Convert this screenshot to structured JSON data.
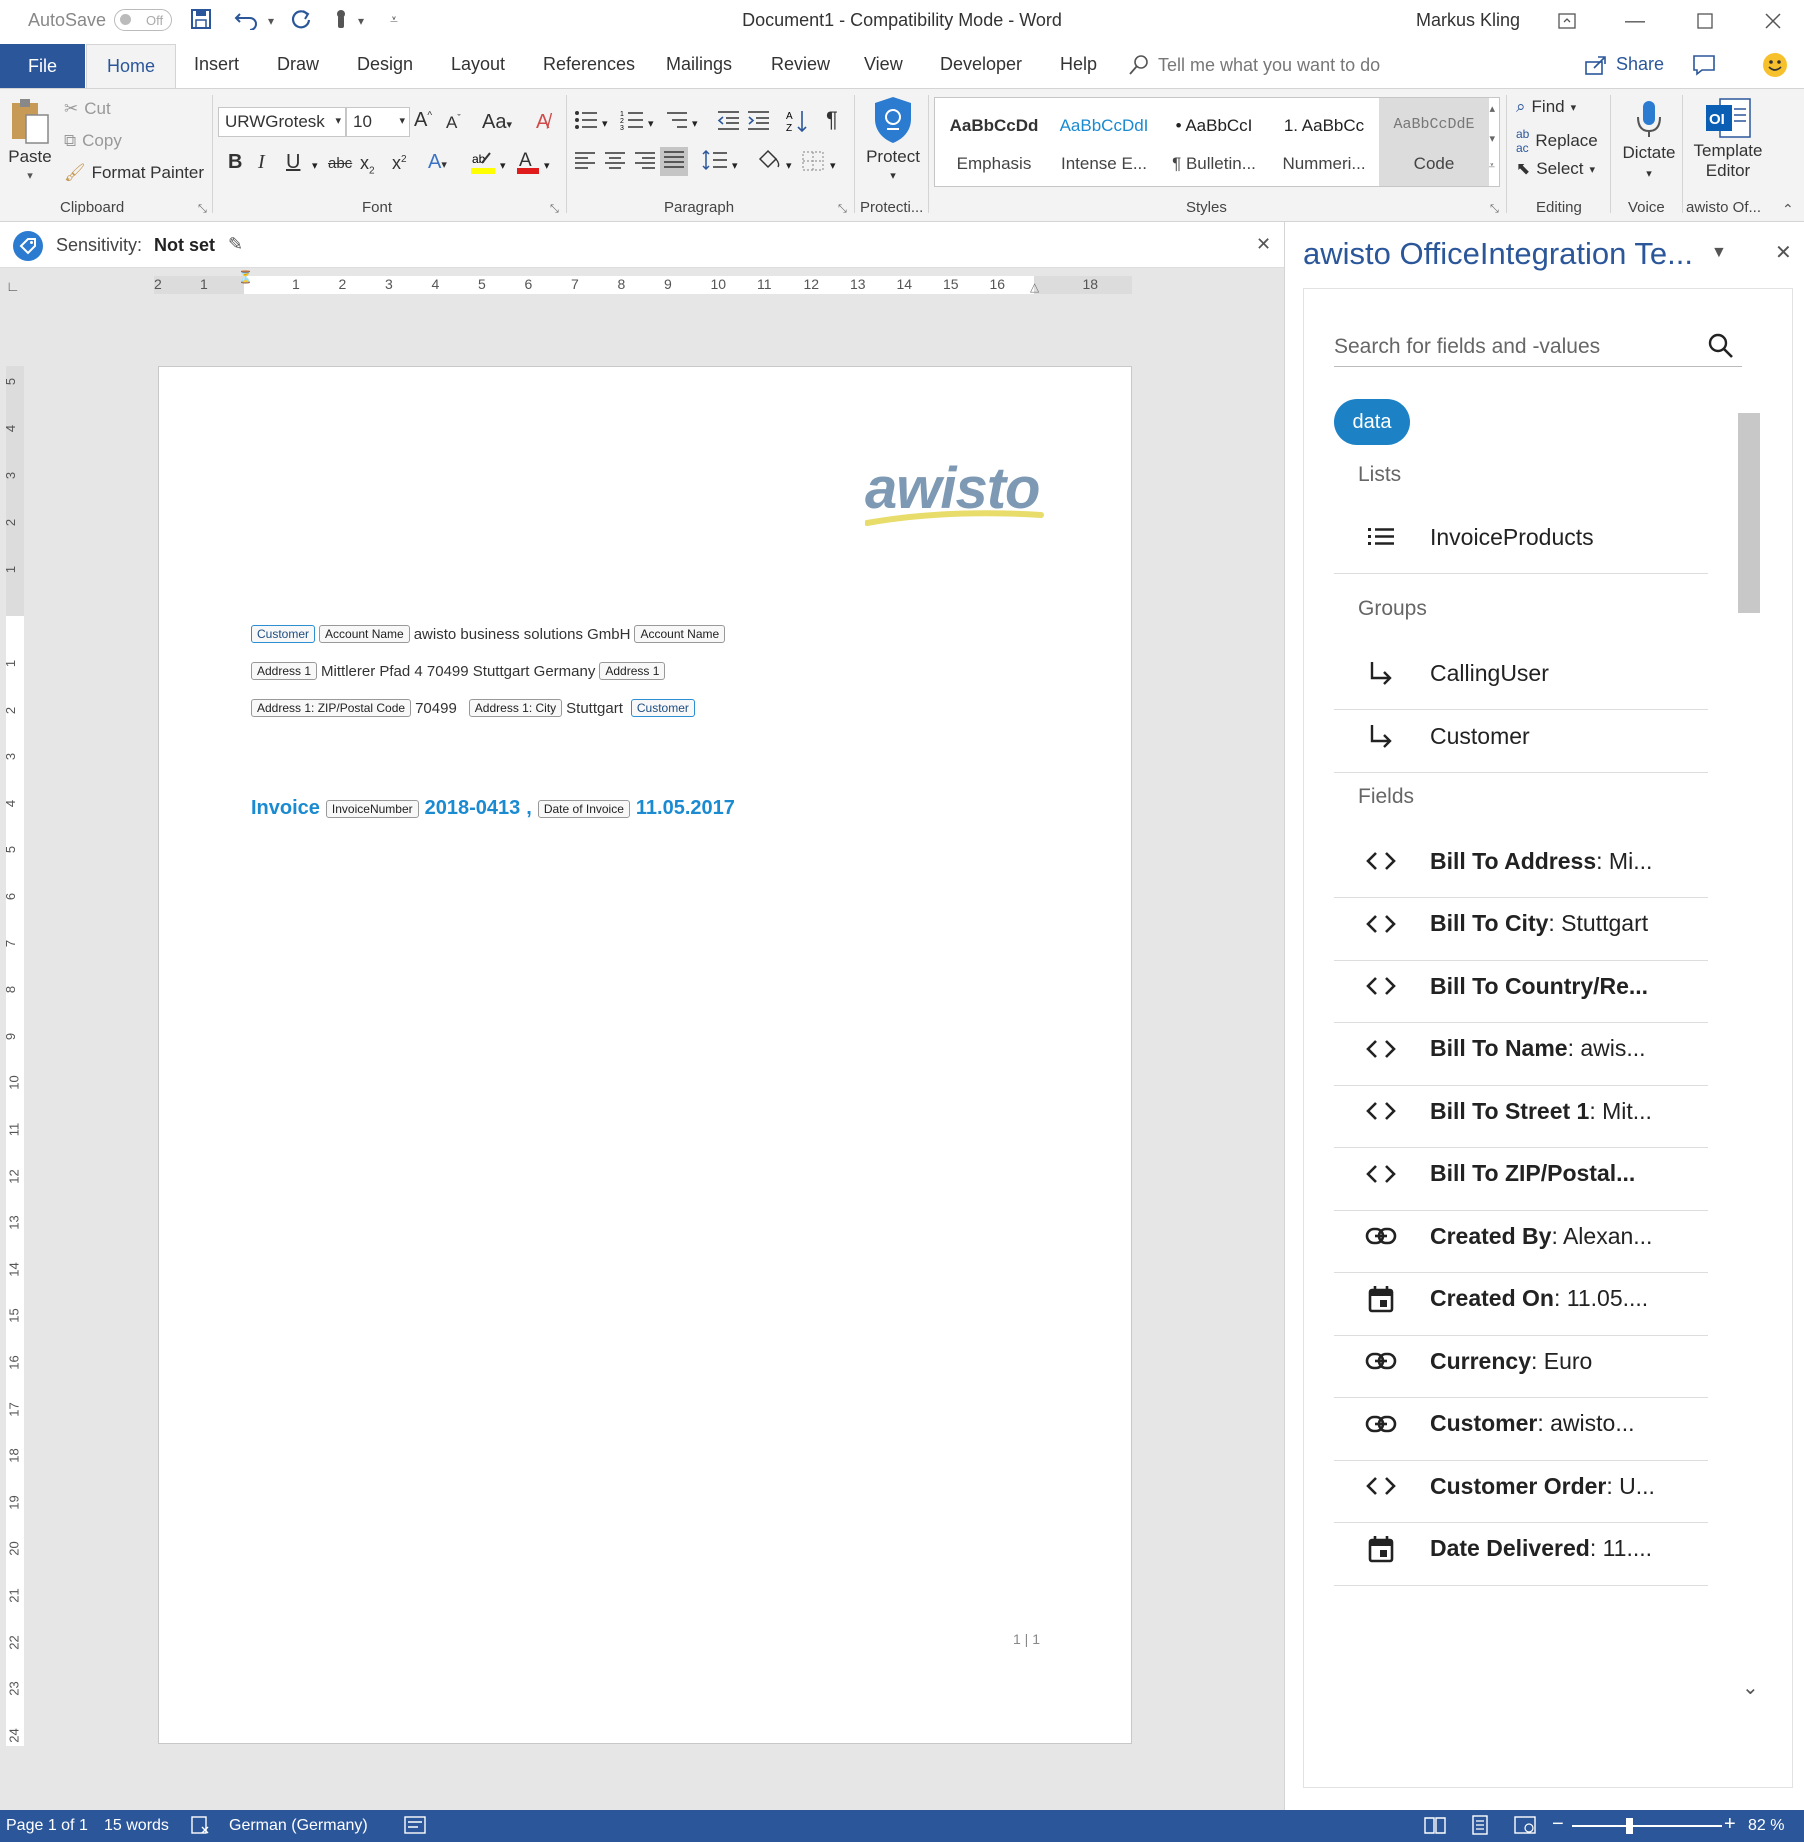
{
  "titlebar": {
    "autosave_label": "AutoSave",
    "autosave_state": "Off",
    "document_title": "Document1  -  Compatibility Mode  -  Word",
    "user_name": "Markus Kling"
  },
  "tabs": {
    "file": "File",
    "home": "Home",
    "items": [
      "Insert",
      "Draw",
      "Design",
      "Layout",
      "References",
      "Mailings",
      "Review",
      "View",
      "Developer",
      "Help"
    ],
    "tell_me_placeholder": "Tell me what you want to do",
    "share": "Share"
  },
  "ribbon": {
    "clipboard": {
      "paste": "Paste",
      "cut": "Cut",
      "copy": "Copy",
      "format_painter": "Format Painter",
      "label": "Clipboard"
    },
    "font": {
      "name": "URWGrotesk",
      "size": "10",
      "label": "Font",
      "bold": "B",
      "italic": "I",
      "underline": "U",
      "strike": "abc",
      "case": "Aa"
    },
    "paragraph": {
      "label": "Paragraph"
    },
    "protection": {
      "protect": "Protect",
      "label": "Protecti..."
    },
    "styles": {
      "label": "Styles",
      "items": [
        {
          "sample": "AaBbCcDd",
          "name": "Emphasis"
        },
        {
          "sample": "AaBbCcDdI",
          "name": "Intense E..."
        },
        {
          "sample": "• AaBbCcI",
          "name": "¶ Bulletin..."
        },
        {
          "sample": "1.  AaBbCc",
          "name": "Nummeri..."
        },
        {
          "sample": "AaBbCcDdE",
          "name": "Code"
        }
      ]
    },
    "editing": {
      "find": "Find",
      "replace": "Replace",
      "select": "Select",
      "label": "Editing"
    },
    "voice": {
      "dictate": "Dictate",
      "label": "Voice"
    },
    "addin": {
      "template": "Template",
      "editor": "Editor",
      "label": "awisto Of..."
    }
  },
  "sensitivity": {
    "label": "Sensitivity:",
    "value": "Not set"
  },
  "ruler": {
    "h_left": [
      "2",
      "1"
    ],
    "h_right": [
      "1",
      "2",
      "3",
      "4",
      "5",
      "6",
      "7",
      "8",
      "9",
      "10",
      "11",
      "12",
      "13",
      "14",
      "15",
      "16",
      "18"
    ],
    "v_top": [
      "5",
      "4",
      "3",
      "2",
      "1"
    ],
    "v_bottom": [
      "1",
      "2",
      "3",
      "4",
      "5",
      "6",
      "7",
      "8",
      "9",
      "10",
      "11",
      "12",
      "13",
      "14",
      "15",
      "16",
      "17",
      "18",
      "19",
      "20",
      "21",
      "22",
      "23",
      "24"
    ]
  },
  "document": {
    "logo": "awisto",
    "line1": {
      "cc_customer": "Customer",
      "cc_account": "Account Name",
      "value": "awisto business solutions GmbH",
      "cc_account_end": "Account Name"
    },
    "line2": {
      "cc_address": "Address 1",
      "value": "Mittlerer Pfad 4 70499 Stuttgart Germany",
      "cc_address_end": "Address 1"
    },
    "line3": {
      "cc_zip": "Address 1: ZIP/Postal Code",
      "zip": "70499",
      "cc_city": "Address 1: City",
      "city": "Stuttgart",
      "cc_customer_end": "Customer"
    },
    "invoice": {
      "label": "Invoice",
      "cc_number": "InvoiceNumber",
      "number": "2018-0413",
      "comma": ",",
      "cc_date": "Date of Invoice",
      "date": "11.05.2017"
    },
    "page_number": "1 | 1"
  },
  "pane": {
    "title": "awisto OfficeIntegration Te...",
    "search_placeholder": "Search for fields and -values",
    "chip": "data",
    "sections": {
      "lists": "Lists",
      "groups": "Groups",
      "fields": "Fields"
    },
    "lists": [
      {
        "icon": "list-icon",
        "label": "InvoiceProducts"
      }
    ],
    "groups": [
      {
        "icon": "group-arrow-icon",
        "label": "CallingUser"
      },
      {
        "icon": "group-arrow-icon",
        "label": "Customer"
      }
    ],
    "fields": [
      {
        "icon": "code-icon",
        "name": "Bill To Address",
        "value": ": Mi..."
      },
      {
        "icon": "code-icon",
        "name": "Bill To City",
        "value": ": Stuttgart"
      },
      {
        "icon": "code-icon",
        "name": "Bill To Country/Re...",
        "value": ""
      },
      {
        "icon": "code-icon",
        "name": "Bill To Name",
        "value": ": awis..."
      },
      {
        "icon": "code-icon",
        "name": "Bill To Street 1",
        "value": ": Mit..."
      },
      {
        "icon": "code-icon",
        "name": "Bill To ZIP/Postal...",
        "value": ""
      },
      {
        "icon": "link-icon",
        "name": "Created By",
        "value": ": Alexan..."
      },
      {
        "icon": "calendar-icon",
        "name": "Created On",
        "value": ": 11.05...."
      },
      {
        "icon": "link-icon",
        "name": "Currency",
        "value": ": Euro"
      },
      {
        "icon": "link-icon",
        "name": "Customer",
        "value": ": awisto..."
      },
      {
        "icon": "code-icon",
        "name": "Customer Order",
        "value": ": U..."
      },
      {
        "icon": "calendar-icon",
        "name": "Date Delivered",
        "value": ": 11...."
      }
    ]
  },
  "statusbar": {
    "page": "Page 1 of 1",
    "words": "15 words",
    "language": "German (Germany)",
    "zoom": "82 %"
  },
  "colors": {
    "word_blue": "#2b579a",
    "accent_blue": "#1d82c5",
    "invoice_blue": "#1a8ad1"
  }
}
